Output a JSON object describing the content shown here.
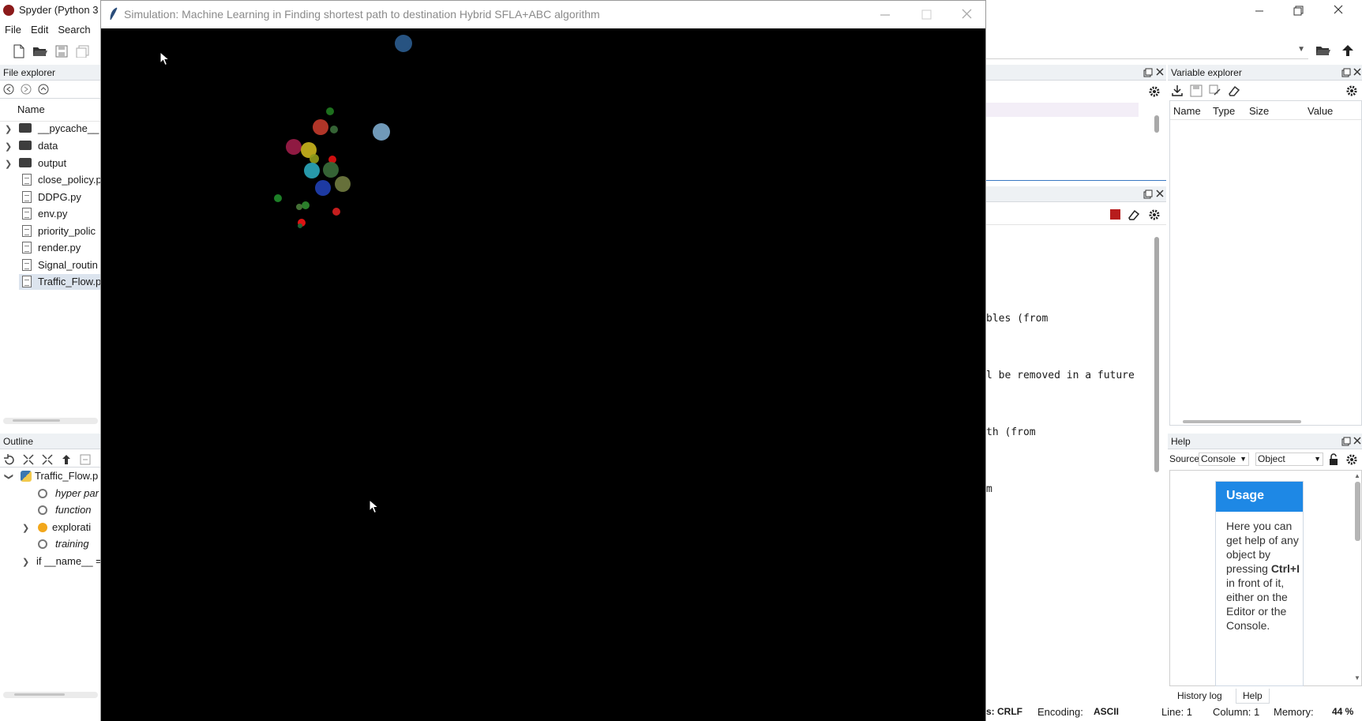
{
  "spyder": {
    "title": "Spyder (Python 3",
    "menu": [
      "File",
      "Edit",
      "Search"
    ],
    "file_explorer": {
      "title": "File explorer",
      "column_name": "Name",
      "items": [
        {
          "kind": "folder",
          "label": "__pycache__"
        },
        {
          "kind": "folder",
          "label": "data"
        },
        {
          "kind": "folder",
          "label": "output"
        },
        {
          "kind": "file",
          "label": "close_policy.p"
        },
        {
          "kind": "file",
          "label": "DDPG.py"
        },
        {
          "kind": "file",
          "label": "env.py"
        },
        {
          "kind": "file",
          "label": "priority_polic"
        },
        {
          "kind": "file",
          "label": "render.py"
        },
        {
          "kind": "file",
          "label": "Signal_routin"
        },
        {
          "kind": "file",
          "label": "Traffic_Flow.p"
        }
      ]
    },
    "outline": {
      "title": "Outline",
      "items": [
        {
          "label": "Traffic_Flow.p",
          "italic": false
        },
        {
          "label": "hyper par",
          "italic": true
        },
        {
          "label": "function",
          "italic": true
        },
        {
          "label": "explorati",
          "italic": false
        },
        {
          "label": "training",
          "italic": true
        },
        {
          "label": "if __name__ =",
          "italic": false
        }
      ]
    },
    "console_lines": [
      "bles (from",
      "l be removed in a future",
      "th (from",
      "m"
    ],
    "variable_explorer": {
      "title": "Variable explorer",
      "columns": [
        "Name",
        "Type",
        "Size",
        "Value"
      ]
    },
    "help": {
      "title": "Help",
      "source_label": "Source",
      "source_value": "Console",
      "object_label": "Object",
      "usage_title": "Usage",
      "usage_text_pre": "Here you can get help of any object by pressing ",
      "usage_shortcut": "Ctrl+I",
      "usage_text_post": " in front of it, either on the Editor or the Console.",
      "tabs": [
        "History log",
        "Help"
      ]
    },
    "status": {
      "eol": "s: CRLF",
      "encoding_label": "Encoding:",
      "encoding_value": "ASCII",
      "line": "Line: 1",
      "column": "Column: 1",
      "memory_label": "Memory:",
      "memory_value": "44 %"
    }
  },
  "simulation": {
    "title": "Simulation: Machine Learning in Finding shortest path to destination Hybrid SFLA+ABC algorithm",
    "particles": [
      {
        "id": 1,
        "color": "#2a5a8c"
      },
      {
        "id": 2,
        "color": "#7aa6c8"
      },
      {
        "id": 3,
        "color": "#1f7a1f"
      },
      {
        "id": 4,
        "color": "#c0392b"
      },
      {
        "id": 5,
        "color": "#3a6b3a"
      },
      {
        "id": 6,
        "color": "#9b1c48"
      },
      {
        "id": 7,
        "color": "#c7b21c"
      },
      {
        "id": 8,
        "color": "#8e9a1a"
      },
      {
        "id": 9,
        "color": "#e01010"
      },
      {
        "id": 10,
        "color": "#2aa5b8"
      },
      {
        "id": 11,
        "color": "#3a6b3a"
      },
      {
        "id": 12,
        "color": "#6f7a3f"
      },
      {
        "id": 13,
        "color": "#1f3fb0"
      },
      {
        "id": 14,
        "color": "#1f8a2a"
      },
      {
        "id": 15,
        "color": "#2f8a2f"
      },
      {
        "id": 16,
        "color": "#4a7a3a"
      },
      {
        "id": 17,
        "color": "#d62020"
      },
      {
        "id": 18,
        "color": "#f01515"
      },
      {
        "id": 19,
        "color": "#1a6a3a"
      }
    ]
  }
}
